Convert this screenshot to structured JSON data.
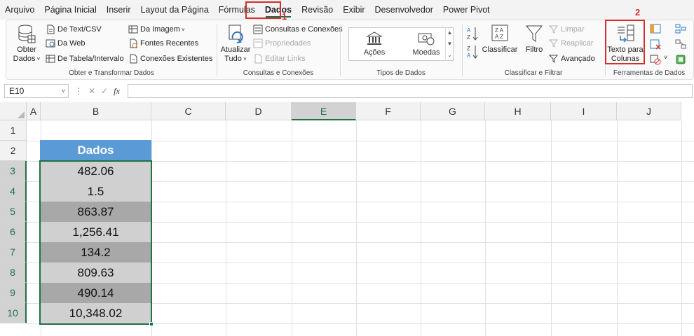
{
  "menu": {
    "items": [
      "Arquivo",
      "Página Inicial",
      "Inserir",
      "Layout da Página",
      "Fórmulas",
      "Dados",
      "Revisão",
      "Exibir",
      "Desenvolvedor",
      "Power Pivot"
    ],
    "active": "Dados"
  },
  "callouts": {
    "one": "1",
    "two": "2"
  },
  "ribbon": {
    "obter": {
      "big_label_1": "Obter",
      "big_label_2": "Dados",
      "de_text": "De Text/CSV",
      "da_web": "Da Web",
      "de_tabela": "De Tabela/Intervalo",
      "da_imagem": "Da Imagem",
      "fontes": "Fontes Recentes",
      "conexoes_exist": "Conexões Existentes",
      "label": "Obter e Transformar Dados"
    },
    "consultas": {
      "big_label_1": "Atualizar",
      "big_label_2": "Tudo",
      "consultas_conexoes": "Consultas e Conexões",
      "propriedades": "Propriedades",
      "editar_links": "Editar Links",
      "label": "Consultas e Conexões"
    },
    "tipos": {
      "acoes": "Ações",
      "moedas": "Moedas",
      "label": "Tipos de Dados"
    },
    "classificar": {
      "classificar": "Classificar",
      "filtro": "Filtro",
      "limpar": "Limpar",
      "reaplicar": "Reaplicar",
      "avancado": "Avançado",
      "label": "Classificar e Filtrar"
    },
    "ferramentas": {
      "texto_1": "Texto para",
      "texto_2": "Colunas",
      "label": "Ferramentas de Dados"
    }
  },
  "formula_bar": {
    "name_box": "E10",
    "fx": "fx",
    "value": ""
  },
  "grid": {
    "columns": [
      "A",
      "B",
      "C",
      "D",
      "E",
      "F",
      "G",
      "H",
      "I",
      "J"
    ],
    "selected_column": "E",
    "rows": [
      "1",
      "2",
      "3",
      "4",
      "5",
      "6",
      "7",
      "8",
      "9",
      "10"
    ],
    "table_header": "Dados",
    "values": [
      "482.06",
      "1.5",
      "863.87",
      "1,256.41",
      "134.2",
      "809.63",
      "490.14",
      "10,348.02"
    ]
  },
  "colors": {
    "accent": "#1e7145",
    "table_header": "#5b9bd5",
    "highlight": "#d32f2f"
  }
}
